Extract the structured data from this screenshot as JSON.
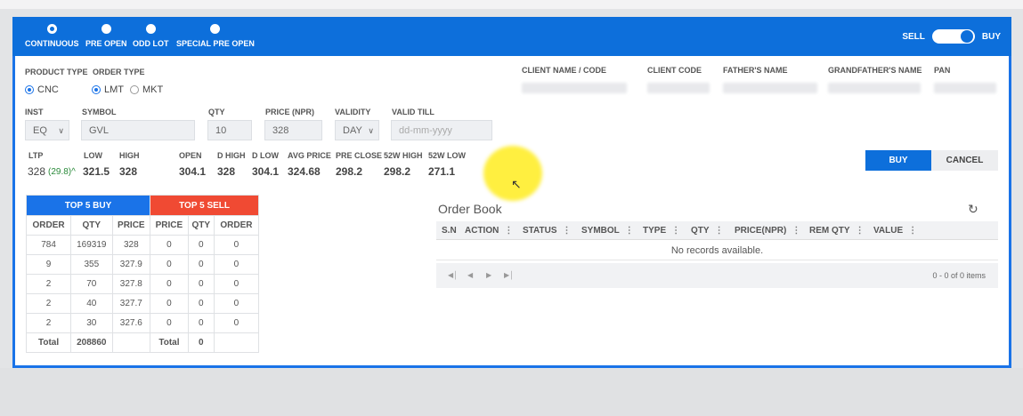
{
  "header": {
    "modes": [
      {
        "label": "CONTINUOUS",
        "selected": true
      },
      {
        "label": "PRE OPEN",
        "selected": false
      },
      {
        "label": "ODD LOT",
        "selected": false
      },
      {
        "label": "SPECIAL PRE OPEN",
        "selected": false
      }
    ],
    "sell_label": "SELL",
    "buy_label": "BUY",
    "toggle_state": "buy"
  },
  "form": {
    "product_type_label": "PRODUCT TYPE",
    "order_type_label": "ORDER TYPE",
    "product_type_options": [
      "CNC"
    ],
    "order_type_options": [
      "LMT",
      "MKT"
    ],
    "inst_label": "INST",
    "inst_value": "EQ",
    "symbol_label": "SYMBOL",
    "symbol_value": "GVL",
    "qty_label": "QTY",
    "qty_value": "10",
    "price_label": "PRICE (NPR)",
    "price_value": "328",
    "validity_label": "VALIDITY",
    "validity_value": "DAY",
    "valid_till_label": "VALID TILL",
    "valid_till_placeholder": "dd-mm-yyyy"
  },
  "client": {
    "client_name_label": "CLIENT NAME / CODE",
    "client_code_label": "CLIENT CODE",
    "father_label": "FATHER'S NAME",
    "grandfather_label": "GRANDFATHER'S NAME",
    "pan_label": "PAN"
  },
  "stats": {
    "ltp_label": "LTP",
    "ltp_value": "328",
    "ltp_change": "(29.8)^",
    "low_label": "LOW",
    "low_value": "321.5",
    "high_label": "HIGH",
    "high_value": "328",
    "open_label": "OPEN",
    "open_value": "304.1",
    "dhigh_label": "D HIGH",
    "dhigh_value": "328",
    "dlow_label": "D LOW",
    "dlow_value": "304.1",
    "avg_label": "AVG PRICE",
    "avg_value": "324.68",
    "preclose_label": "PRE CLOSE",
    "preclose_value": "298.2",
    "w52high_label": "52W HIGH",
    "w52high_value": "298.2",
    "w52low_label": "52W LOW",
    "w52low_value": "271.1"
  },
  "actions": {
    "buy_label": "BUY",
    "cancel_label": "CANCEL"
  },
  "top5": {
    "buy_title": "TOP 5 BUY",
    "sell_title": "TOP 5 SELL",
    "columns": [
      "ORDER",
      "QTY",
      "PRICE",
      "PRICE",
      "QTY",
      "ORDER"
    ],
    "rows": [
      [
        "784",
        "169319",
        "328",
        "0",
        "0",
        "0"
      ],
      [
        "9",
        "355",
        "327.9",
        "0",
        "0",
        "0"
      ],
      [
        "2",
        "70",
        "327.8",
        "0",
        "0",
        "0"
      ],
      [
        "2",
        "40",
        "327.7",
        "0",
        "0",
        "0"
      ],
      [
        "2",
        "30",
        "327.6",
        "0",
        "0",
        "0"
      ]
    ],
    "total_label": "Total",
    "buy_total": "208860",
    "sell_total": "0"
  },
  "order_book": {
    "title": "Order Book",
    "columns": [
      "S.N",
      "ACTION",
      "STATUS",
      "SYMBOL",
      "TYPE",
      "QTY",
      "PRICE(NPR)",
      "REM QTY",
      "VALUE"
    ],
    "empty_text": "No records available.",
    "pager_info": "0 - 0 of 0 items"
  },
  "colors": {
    "primary": "#0d6fdb",
    "sell": "#f04a33",
    "ltp_change": "#2a8a3a"
  }
}
